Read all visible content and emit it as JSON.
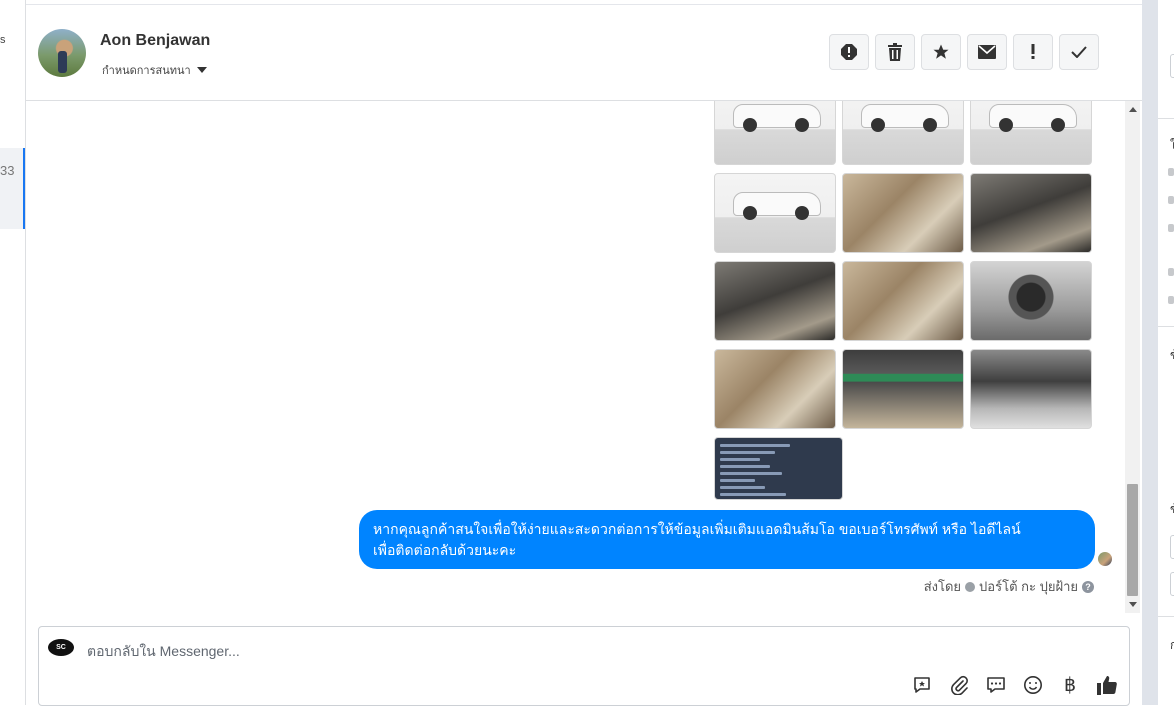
{
  "left_column": {
    "top_char": "s",
    "selected_text": "33"
  },
  "header": {
    "contact_name": "Aon Benjawan",
    "conversation_setting": "กำหนดการสนทนา",
    "actions": [
      {
        "name": "alert-icon"
      },
      {
        "name": "trash-icon"
      },
      {
        "name": "star-icon"
      },
      {
        "name": "envelope-icon"
      },
      {
        "name": "exclamation-icon"
      },
      {
        "name": "checkmark-icon"
      }
    ]
  },
  "chat": {
    "photos": [
      {
        "kind": "car-rear-side"
      },
      {
        "kind": "car-side"
      },
      {
        "kind": "car-side-right"
      },
      {
        "kind": "car-front-wheel"
      },
      {
        "kind": "door-interior"
      },
      {
        "kind": "dashboard"
      },
      {
        "kind": "gear-console"
      },
      {
        "kind": "rear-seats"
      },
      {
        "kind": "gauge-cluster"
      },
      {
        "kind": "front-interior"
      },
      {
        "kind": "center-console"
      },
      {
        "kind": "engine-bay"
      },
      {
        "kind": "spec-sheet"
      }
    ],
    "message": {
      "line1": "หากคุณลูกค้าสนใจเพื่อให้ง่ายและสะดวกต่อการให้ข้อมูลเพิ่มเติมแอดมินส้มโอ ขอเบอร์โทรศัพท์ หรือ ไอดีไลน์",
      "line2": "เพื่อติดต่อกลับด้วยนะคะ"
    },
    "sent_by_label": "ส่งโดย",
    "sent_by_name": "ปอร์โต้ กะ ปุยฝ้าย",
    "help_mark": "?"
  },
  "composer": {
    "placeholder": "ตอบกลับใน Messenger...",
    "brand_text": "SC",
    "currency_symbol": "฿",
    "tools": [
      "saved-reply-icon",
      "attachment-icon",
      "quick-reply-icon",
      "emoji-icon",
      "baht-icon",
      "like-icon"
    ]
  },
  "right_panel": {
    "lines": [
      "ใ",
      "ข้",
      "ข้",
      "ก"
    ]
  },
  "colors": {
    "bubble": "#0084ff",
    "accent": "#1877f2",
    "border": "#dddfe2"
  }
}
